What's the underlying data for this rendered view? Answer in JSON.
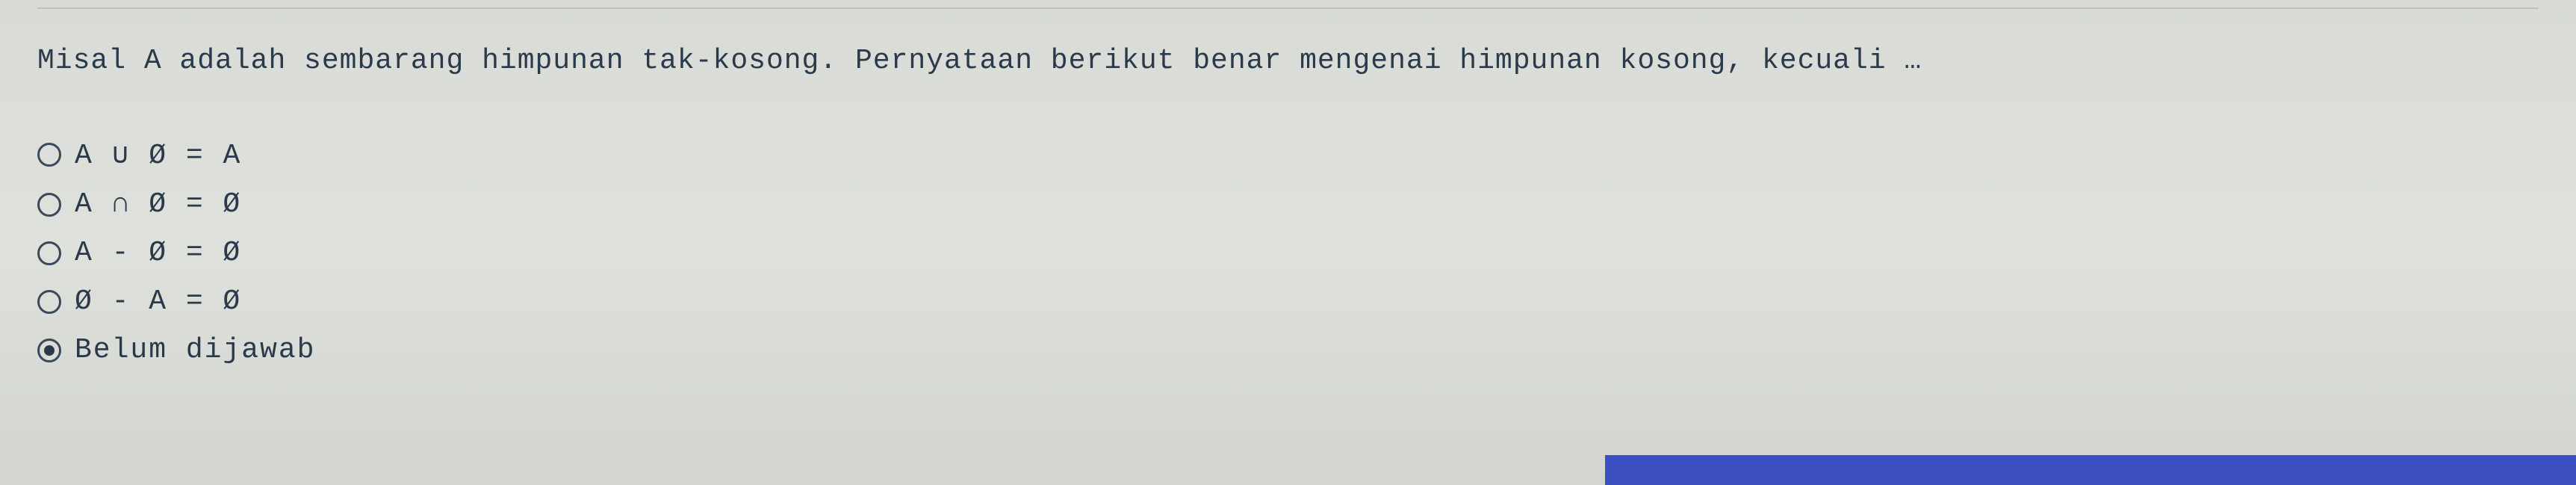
{
  "question": {
    "text": "Misal A adalah sembarang himpunan tak-kosong. Pernyataan berikut benar mengenai himpunan kosong, kecuali …"
  },
  "options": [
    {
      "label": "A ∪ Ø = A",
      "selected": false
    },
    {
      "label": "A ∩ Ø = Ø",
      "selected": false
    },
    {
      "label": "A - Ø = Ø",
      "selected": false
    },
    {
      "label": "Ø - A = Ø",
      "selected": false
    },
    {
      "label": "Belum dijawab",
      "selected": true
    }
  ]
}
